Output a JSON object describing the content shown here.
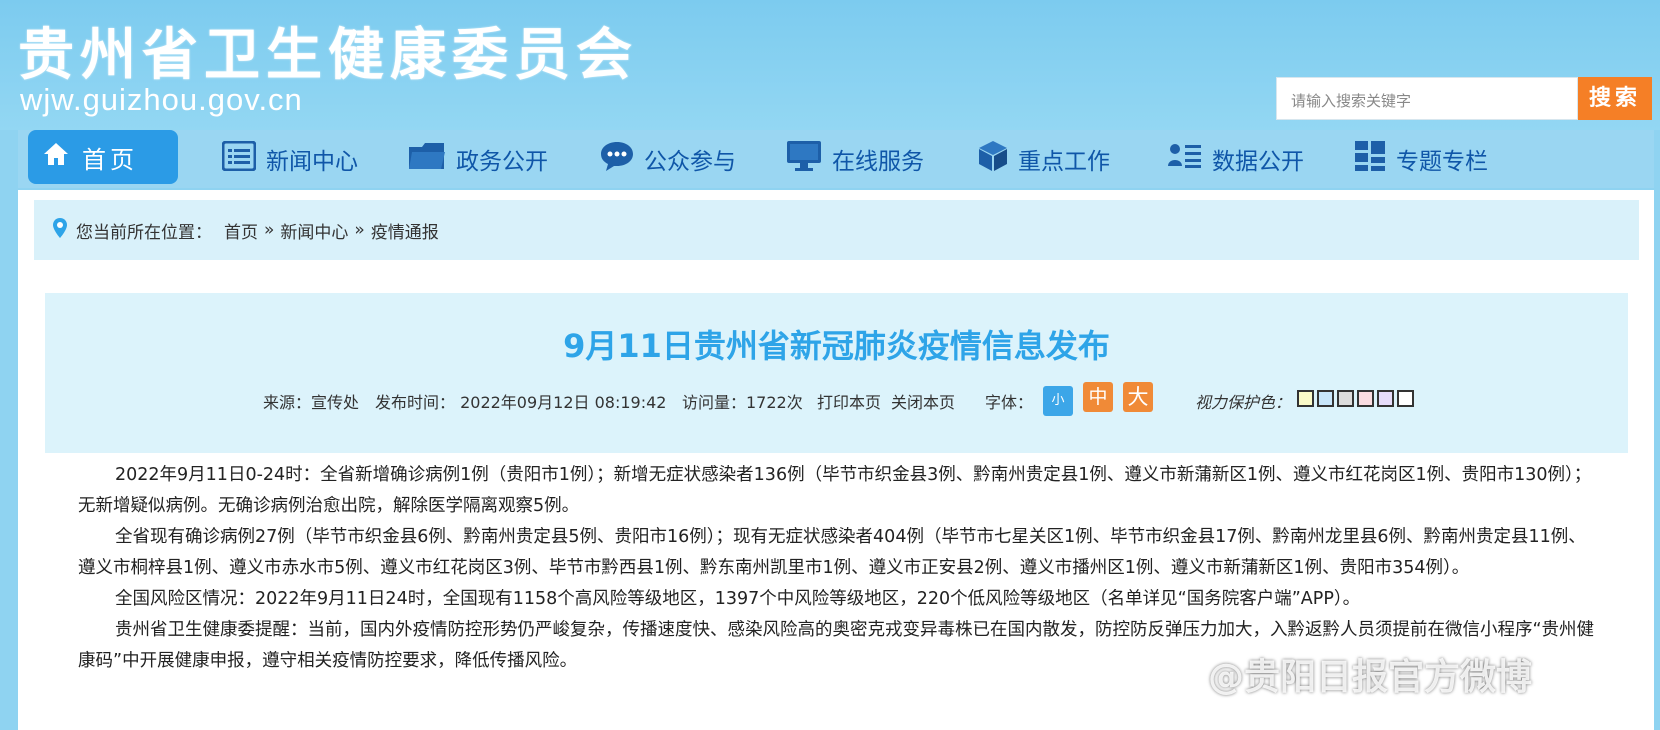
{
  "site": {
    "title": "贵州省卫生健康委员会",
    "url": "wjw.guizhou.gov.cn",
    "search_placeholder": "请输入搜索关键字",
    "search_button": "搜索"
  },
  "nav": {
    "items": [
      {
        "label": "首页",
        "icon": "home-icon"
      },
      {
        "label": "新闻中心",
        "icon": "list-icon"
      },
      {
        "label": "政务公开",
        "icon": "folder-icon"
      },
      {
        "label": "公众参与",
        "icon": "chat-icon"
      },
      {
        "label": "在线服务",
        "icon": "monitor-icon"
      },
      {
        "label": "重点工作",
        "icon": "cube-icon"
      },
      {
        "label": "数据公开",
        "icon": "people-list-icon"
      },
      {
        "label": "专题专栏",
        "icon": "grid-icon"
      }
    ]
  },
  "breadcrumb": {
    "prefix": "您当前所在位置：",
    "items": [
      "首页",
      "新闻中心",
      "疫情通报"
    ],
    "separator": "»"
  },
  "article": {
    "title": "9月11日贵州省新冠肺炎疫情信息发布",
    "source": "来源：宣传处",
    "time": "发布时间： 2022年09月12日 08:19:42",
    "views": "访问量：1722次",
    "print": "打印本页",
    "close": "关闭本页",
    "font_label": "字体：",
    "font_small": "小",
    "font_medium": "中",
    "font_large": "大",
    "eye_label": "视力保护色：",
    "eye_colors": [
      "#fafac8",
      "#c8e6fa",
      "#dcdcdc",
      "#fadce1",
      "#e6dcfa",
      "#ffffff"
    ],
    "paragraphs": [
      "2022年9月11日0-24时：全省新增确诊病例1例（贵阳市1例）；新增无症状感染者136例（毕节市织金县3例、黔南州贵定县1例、遵义市新蒲新区1例、遵义市红花岗区1例、贵阳市130例）；无新增疑似病例。无确诊病例治愈出院，解除医学隔离观察5例。",
      "全省现有确诊病例27例（毕节市织金县6例、黔南州贵定县5例、贵阳市16例）；现有无症状感染者404例（毕节市七星关区1例、毕节市织金县17例、黔南州龙里县6例、黔南州贵定县11例、遵义市桐梓县1例、遵义市赤水市5例、遵义市红花岗区3例、毕节市黔西县1例、黔东南州凯里市1例、遵义市正安县2例、遵义市播州区1例、遵义市新蒲新区1例、贵阳市354例）。",
      "全国风险区情况：2022年9月11日24时，全国现有1158个高风险等级地区，1397个中风险等级地区，220个低风险等级地区（名单详见“国务院客户端”APP）。",
      "贵州省卫生健康委提醒：当前，国内外疫情防控形势仍严峻复杂，传播速度快、感染风险高的奥密克戎变异毒株已在国内散发，防控防反弹压力加大，入黔返黔人员须提前在微信小程序“贵州健康码”中开展健康申报，遵守相关疫情防控要求，降低传播风险。"
    ]
  },
  "watermark": "@贵阳日报官方微博",
  "colors": {
    "header_bg": "#7ccbef",
    "nav_bg": "#9ad6f2",
    "nav_text": "#0f56a8",
    "home_bg": "#2b9be6",
    "search_btn": "#f57f26",
    "title_color": "#2ea4e8",
    "font_small_bg": "#3ca6e8",
    "font_medium_bg": "#f08a37",
    "font_large_bg": "#f08a37"
  }
}
